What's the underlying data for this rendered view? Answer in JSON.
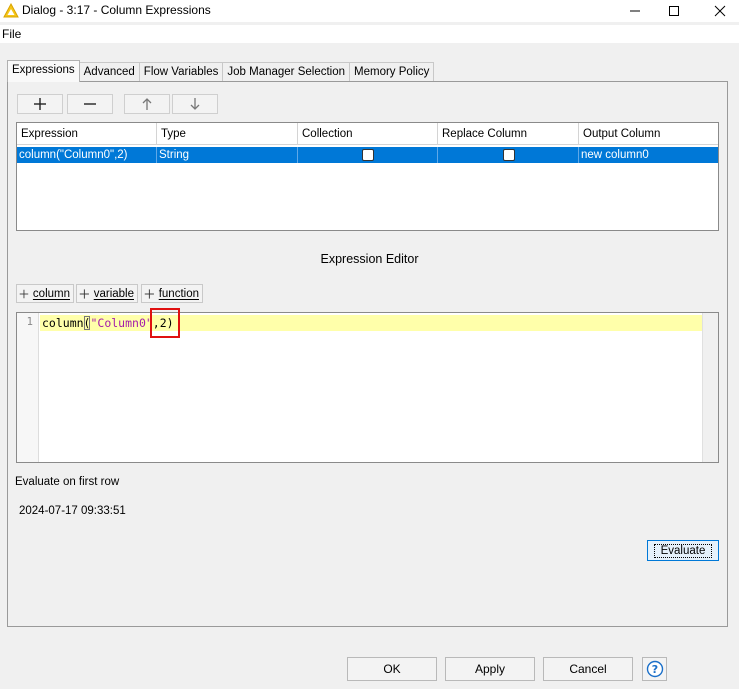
{
  "window": {
    "title": "Dialog - 3:17 - Column Expressions"
  },
  "menu": {
    "file": "File"
  },
  "tabs": [
    {
      "label": "Expressions",
      "active": true
    },
    {
      "label": "Advanced"
    },
    {
      "label": "Flow Variables"
    },
    {
      "label": "Job Manager Selection"
    },
    {
      "label": "Memory Policy"
    }
  ],
  "table": {
    "columns": [
      "Expression",
      "Type",
      "Collection",
      "Replace Column",
      "Output Column"
    ],
    "rows": [
      {
        "expression": "column(\"Column0\",2)",
        "type": "String",
        "collection": false,
        "replace_column": false,
        "output_column": "new column0",
        "selected": true
      }
    ]
  },
  "editor": {
    "section_title": "Expression Editor",
    "insert_buttons": {
      "column": "column",
      "variable": "variable",
      "function": "function"
    },
    "line_number": "1",
    "code": {
      "fn": "column",
      "open": "(",
      "str": "\"Column0\"",
      "rest": ",2)"
    }
  },
  "evaluate": {
    "label": "Evaluate on first row",
    "result": "2024-07-17 09:33:51",
    "button": "Evaluate"
  },
  "footer": {
    "ok": "OK",
    "apply": "Apply",
    "cancel": "Cancel",
    "help": "?"
  },
  "colors": {
    "selection": "#0078d7",
    "string": "#a31caa",
    "highlight": "#e01010"
  }
}
